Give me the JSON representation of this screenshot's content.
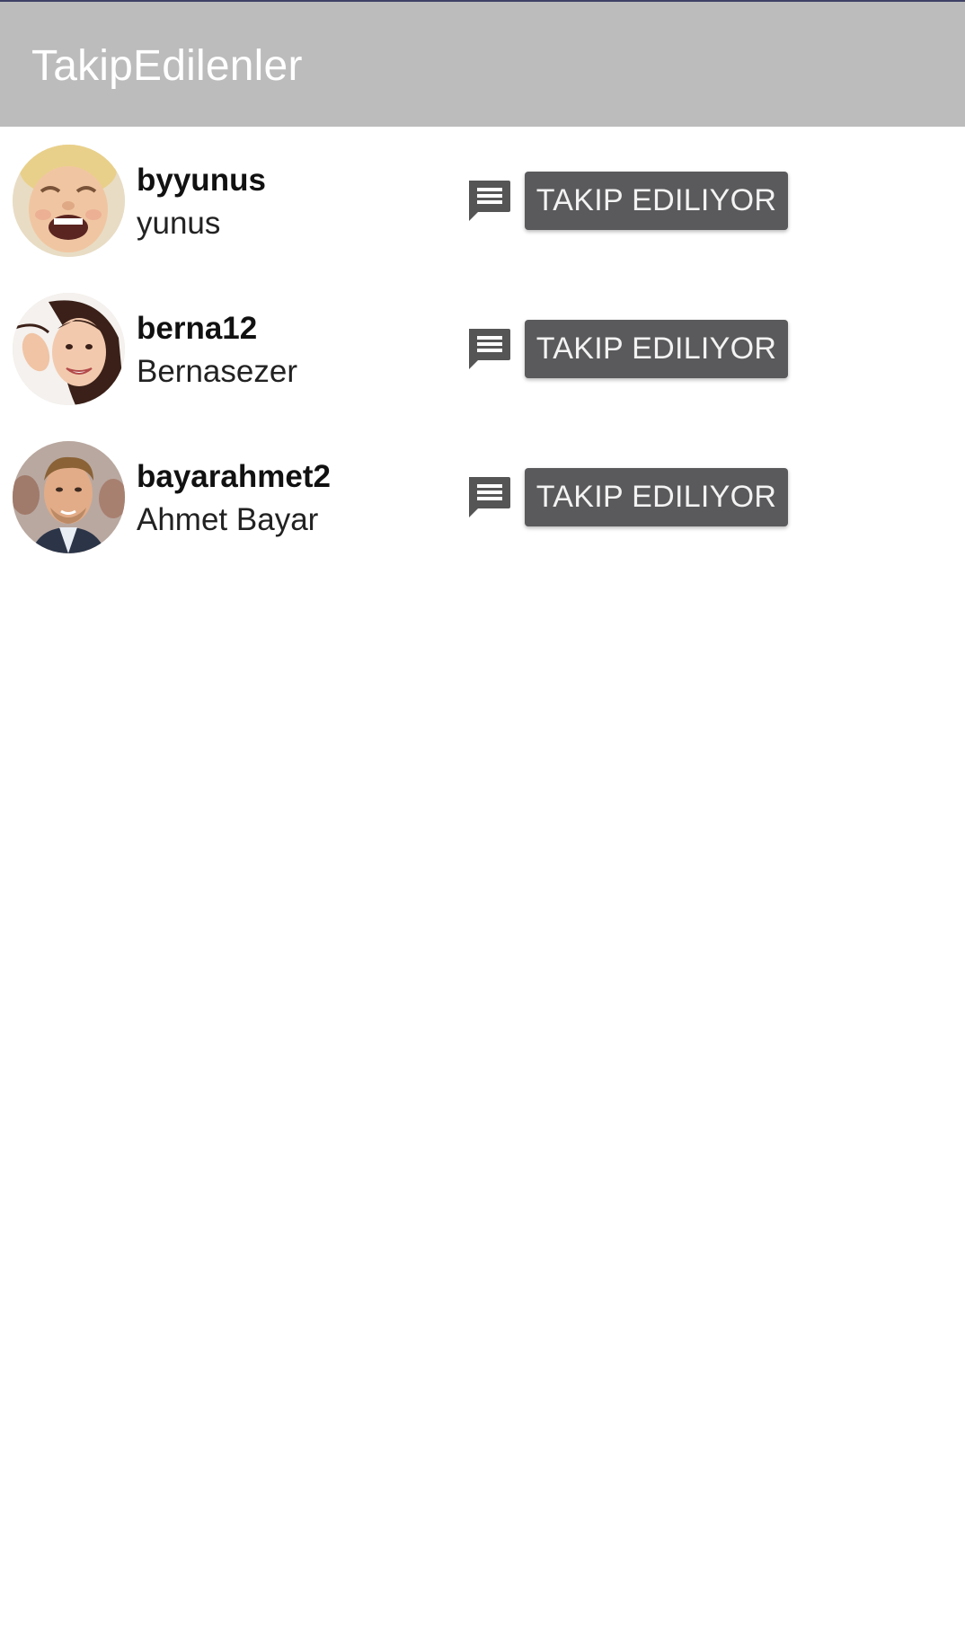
{
  "app_bar": {
    "title": "TakipEdilenler",
    "background": "#bcbcbc"
  },
  "following": [
    {
      "username": "byyunus",
      "full_name": "yunus",
      "action_label": "TAKIP EDILIYOR",
      "message_icon": "chat-message-icon"
    },
    {
      "username": "berna12",
      "full_name": "Bernasezer",
      "action_label": "TAKIP EDILIYOR",
      "message_icon": "chat-message-icon"
    },
    {
      "username": "bayarahmet2",
      "full_name": "Ahmet Bayar",
      "action_label": "TAKIP EDILIYOR",
      "message_icon": "chat-message-icon"
    }
  ],
  "colors": {
    "button_bg": "#5a595b",
    "button_text": "#f3f3f3",
    "icon": "#555555"
  }
}
